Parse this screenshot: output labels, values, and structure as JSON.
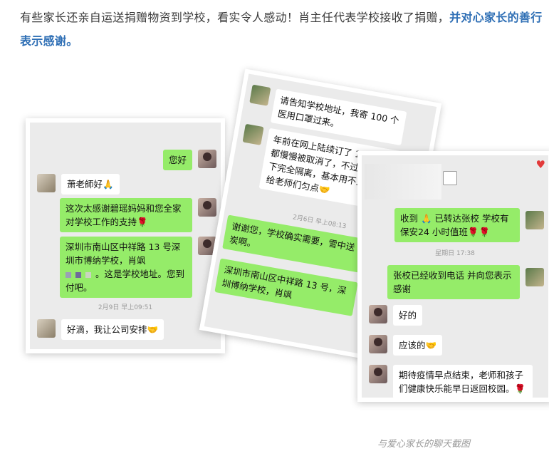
{
  "article": {
    "paragraph_normal": "有些家长还亲自运送捐赠物资到学校，看实令人感动！肖主任代表学校接收了捐赠，",
    "paragraph_highlight": "并对心家长的善行表示感谢。"
  },
  "chat1": {
    "msg1": "您好",
    "msg2": "萧老師好🙏",
    "msg3": "这次太感谢碧瑶妈妈和您全家对学校工作的支持🌹",
    "msg4_pre": "深圳市南山区中祥路 13 号深圳市博纳学校，肖飒",
    "msg4_post": "。这是学校地址。您到付吧。",
    "time": "2月9日 早上09:51",
    "msg5": "好滴，我让公司安排🤝"
  },
  "chat2": {
    "msg1": "请告知学校地址，我寄 100 个医用口罩过来。",
    "msg2": "年前在网上陆续订了 1000 个，都慢慢被取消了，不过我们在乡下完全隔离，基本用不上，可以给老师们匀点🤝",
    "time": "2月6日 早上08:13",
    "msg3": "谢谢您，学校确实需要，雪中送炭啊。",
    "msg4": "深圳市南山区中祥路 13 号，深圳博纳学校，肖飒"
  },
  "chat3": {
    "msg1": "收到 🙏 已转达张校 学校有保安24 小时值班🌹🌹",
    "time": "星期日 17:38",
    "msg2": "张校已经收到电话 并向您表示感谢",
    "msg3": "好的",
    "msg4": "应该的🤝",
    "msg5": "期待疫情早点结束，老师和孩子们健康快乐能早日返回校园。🌹"
  },
  "caption": "与爱心家长的聊天截图"
}
